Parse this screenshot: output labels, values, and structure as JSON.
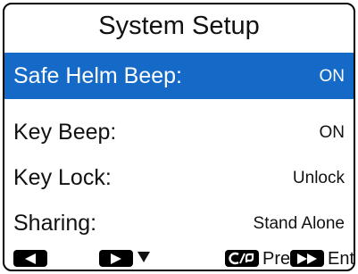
{
  "screen": {
    "title": "System Setup",
    "selection_color": "#1569c7",
    "items": [
      {
        "label": "Safe Helm Beep:",
        "value": "ON",
        "selected": true
      },
      {
        "label": "Key Beep:",
        "value": "ON",
        "selected": false
      },
      {
        "label": "Key Lock:",
        "value": "Unlock",
        "selected": false
      },
      {
        "label": "Sharing:",
        "value": "Stand Alone",
        "selected": false
      }
    ]
  },
  "softkeys": [
    {
      "icon": "left-arrow-key-icon",
      "label": ""
    },
    {
      "icon": "right-arrow-key-icon",
      "extra_icon": "down-arrow-icon",
      "label": ""
    },
    {
      "icon": "clear-key-icon",
      "label": "Prev"
    },
    {
      "icon": "fast-forward-key-icon",
      "label": "Ent"
    }
  ]
}
